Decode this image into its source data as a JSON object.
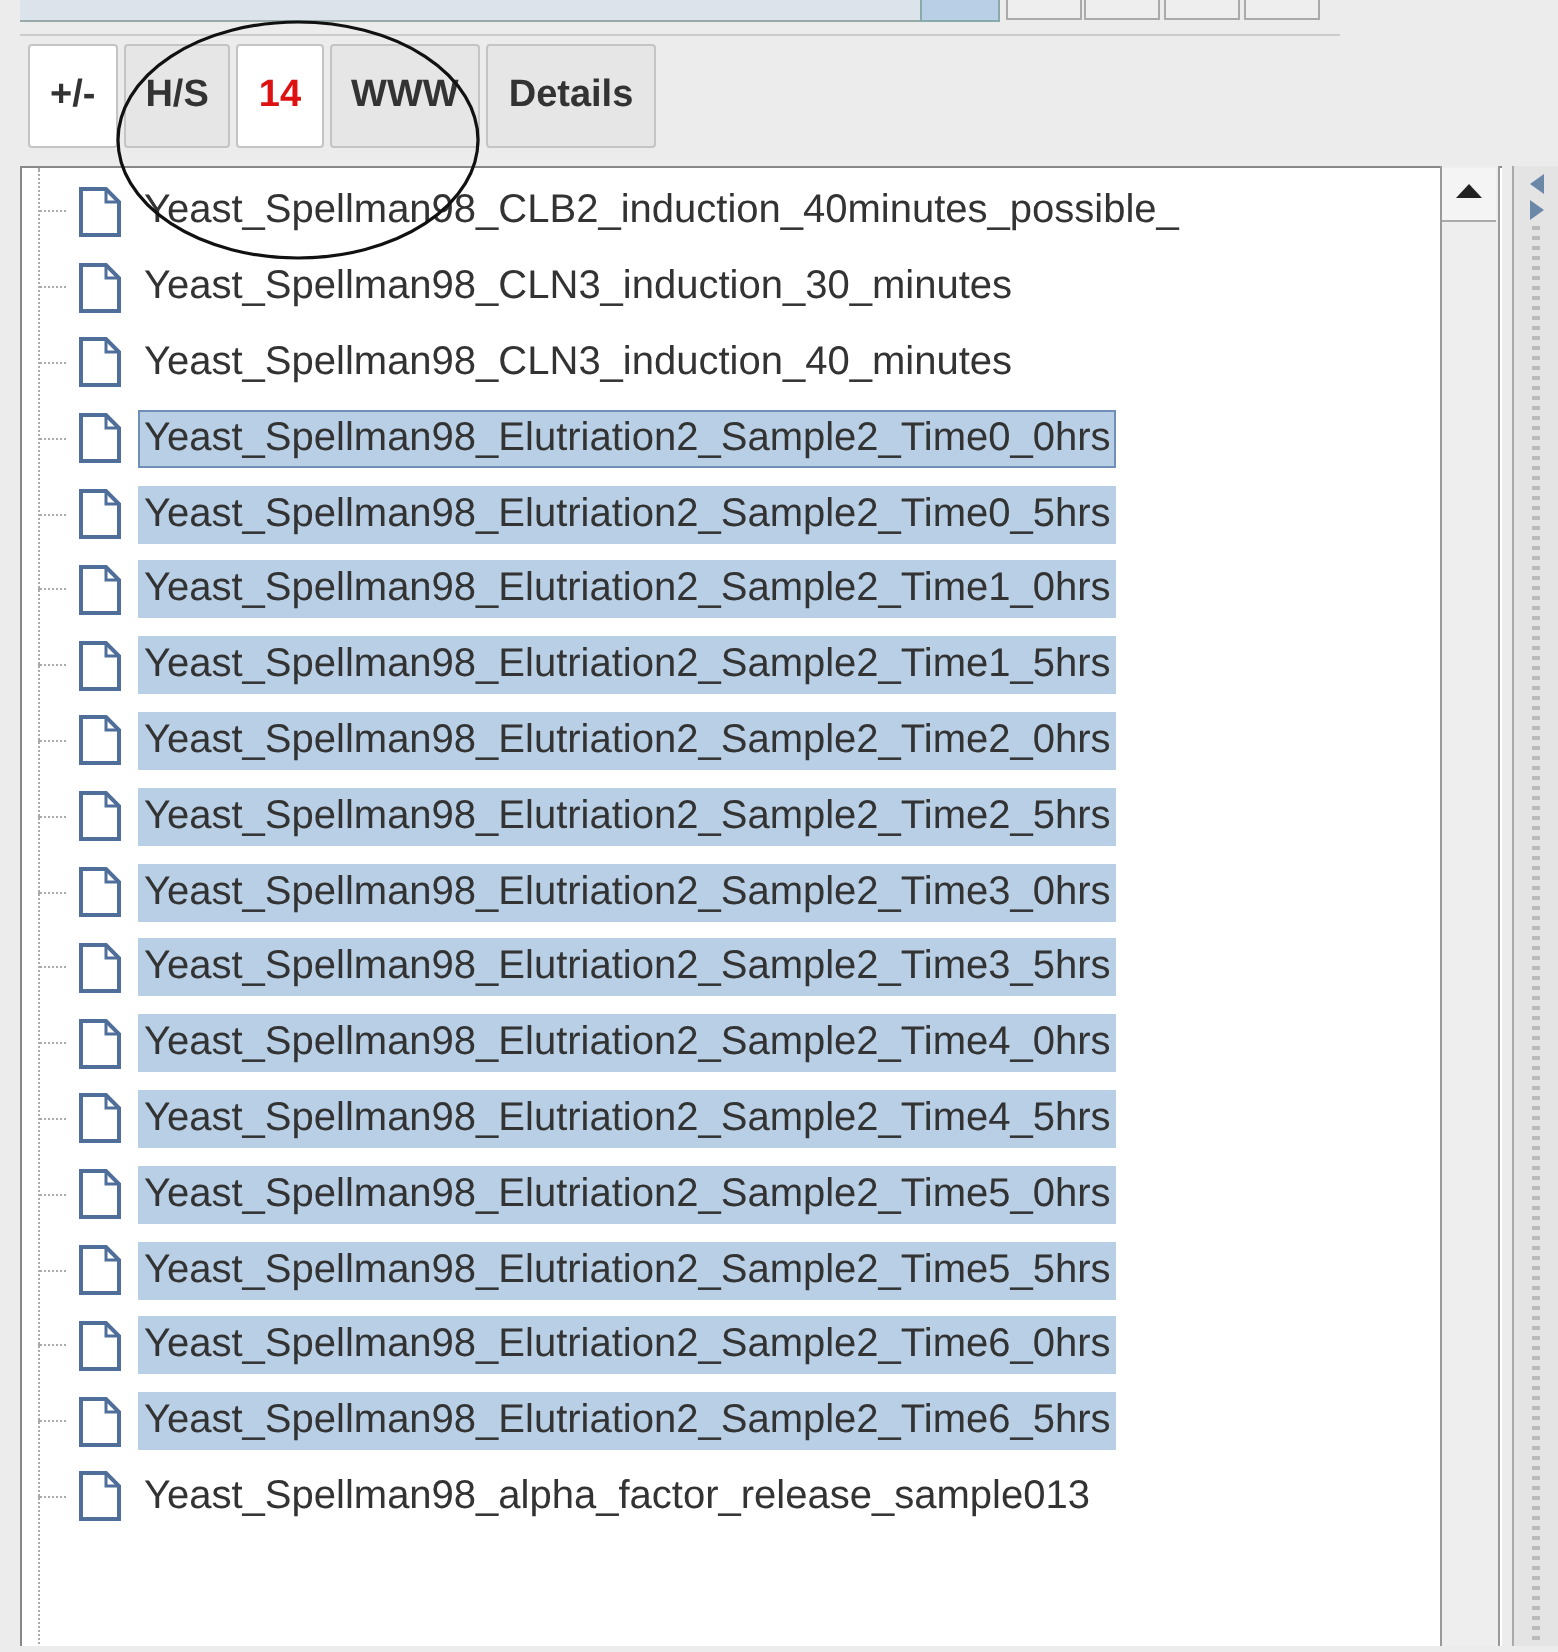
{
  "toolbar": {
    "buttons": [
      {
        "label": "+/-",
        "active": true,
        "color": "#333333"
      },
      {
        "label": "H/S",
        "active": false,
        "color": "#333333"
      },
      {
        "label": "14",
        "active": true,
        "color": "#dd1111"
      },
      {
        "label": "WWW",
        "active": false,
        "color": "#333333"
      },
      {
        "label": "Details",
        "active": false,
        "color": "#333333"
      }
    ]
  },
  "tree": {
    "items": [
      {
        "label": "Yeast_Spellman98_CLB2_induction_40minutes_possible_",
        "selected": false,
        "focused": false
      },
      {
        "label": "Yeast_Spellman98_CLN3_induction_30_minutes",
        "selected": false,
        "focused": false
      },
      {
        "label": "Yeast_Spellman98_CLN3_induction_40_minutes",
        "selected": false,
        "focused": false
      },
      {
        "label": "Yeast_Spellman98_Elutriation2_Sample2_Time0_0hrs",
        "selected": true,
        "focused": true
      },
      {
        "label": "Yeast_Spellman98_Elutriation2_Sample2_Time0_5hrs",
        "selected": true,
        "focused": false
      },
      {
        "label": "Yeast_Spellman98_Elutriation2_Sample2_Time1_0hrs",
        "selected": true,
        "focused": false
      },
      {
        "label": "Yeast_Spellman98_Elutriation2_Sample2_Time1_5hrs",
        "selected": true,
        "focused": false
      },
      {
        "label": "Yeast_Spellman98_Elutriation2_Sample2_Time2_0hrs",
        "selected": true,
        "focused": false
      },
      {
        "label": "Yeast_Spellman98_Elutriation2_Sample2_Time2_5hrs",
        "selected": true,
        "focused": false
      },
      {
        "label": "Yeast_Spellman98_Elutriation2_Sample2_Time3_0hrs",
        "selected": true,
        "focused": false
      },
      {
        "label": "Yeast_Spellman98_Elutriation2_Sample2_Time3_5hrs",
        "selected": true,
        "focused": false
      },
      {
        "label": "Yeast_Spellman98_Elutriation2_Sample2_Time4_0hrs",
        "selected": true,
        "focused": false
      },
      {
        "label": "Yeast_Spellman98_Elutriation2_Sample2_Time4_5hrs",
        "selected": true,
        "focused": false
      },
      {
        "label": "Yeast_Spellman98_Elutriation2_Sample2_Time5_0hrs",
        "selected": true,
        "focused": false
      },
      {
        "label": "Yeast_Spellman98_Elutriation2_Sample2_Time5_5hrs",
        "selected": true,
        "focused": false
      },
      {
        "label": "Yeast_Spellman98_Elutriation2_Sample2_Time6_0hrs",
        "selected": true,
        "focused": false
      },
      {
        "label": "Yeast_Spellman98_Elutriation2_Sample2_Time6_5hrs",
        "selected": true,
        "focused": false
      },
      {
        "label": "Yeast_Spellman98_alpha_factor_release_sample013",
        "selected": false,
        "focused": false
      }
    ]
  }
}
